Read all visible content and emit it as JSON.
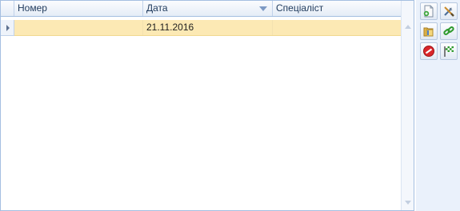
{
  "grid": {
    "columns": [
      {
        "label": "Номер"
      },
      {
        "label": "Дата",
        "sorted": "descending"
      },
      {
        "label": "Спеціаліст"
      }
    ],
    "rows": [
      {
        "number": "",
        "date": "21.11.2016",
        "specialist": "",
        "selected": true
      }
    ]
  },
  "toolbar": {
    "buttons": [
      {
        "icon": "add-document-icon"
      },
      {
        "icon": "tools-icon"
      },
      {
        "icon": "folder-open-icon"
      },
      {
        "icon": "link-icon"
      },
      {
        "icon": "delete-icon"
      },
      {
        "icon": "finish-flag-icon"
      }
    ]
  },
  "colors": {
    "selected_row": "#fce9b4",
    "border": "#a5bfe1",
    "header_text": "#1e395b"
  }
}
